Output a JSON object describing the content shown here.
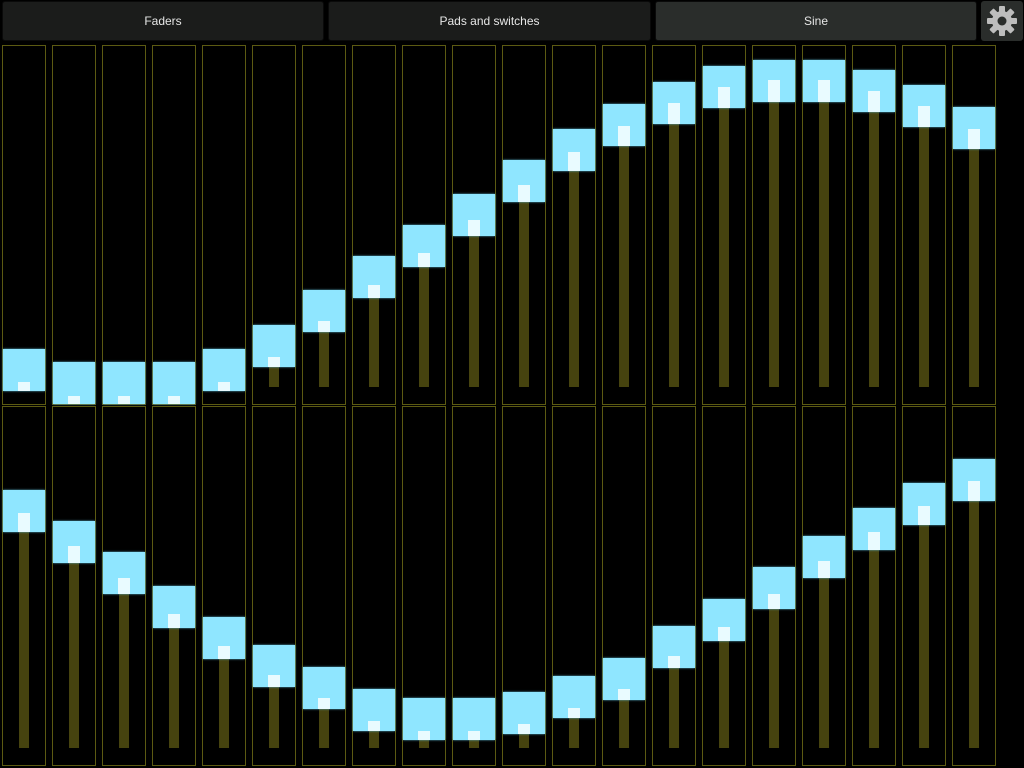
{
  "tabs": [
    {
      "label": "Faders",
      "active": false
    },
    {
      "label": "Pads and switches",
      "active": false
    },
    {
      "label": "Sine",
      "active": true
    }
  ],
  "settings": {
    "icon": "gear-icon"
  },
  "colors": {
    "background": "#000000",
    "fader_border": "#5c5a12",
    "fader_track": "#46430f",
    "knob": "#8fe6ff",
    "knob_center": "#e9fbff",
    "tab_bg": "#1b1c1b",
    "tab_active_bg": "#2a2d2b",
    "tab_text": "#e6e6e6"
  },
  "fader_rows": [
    {
      "name": "top",
      "values": [
        0.05,
        0.01,
        0.0,
        0.01,
        0.05,
        0.13,
        0.24,
        0.35,
        0.45,
        0.55,
        0.66,
        0.76,
        0.84,
        0.91,
        0.96,
        0.98,
        0.98,
        0.95,
        0.9,
        0.83
      ]
    },
    {
      "name": "bottom",
      "values": [
        0.76,
        0.66,
        0.56,
        0.45,
        0.35,
        0.26,
        0.19,
        0.12,
        0.09,
        0.09,
        0.11,
        0.16,
        0.22,
        0.32,
        0.41,
        0.51,
        0.61,
        0.7,
        0.78,
        0.86
      ]
    }
  ]
}
